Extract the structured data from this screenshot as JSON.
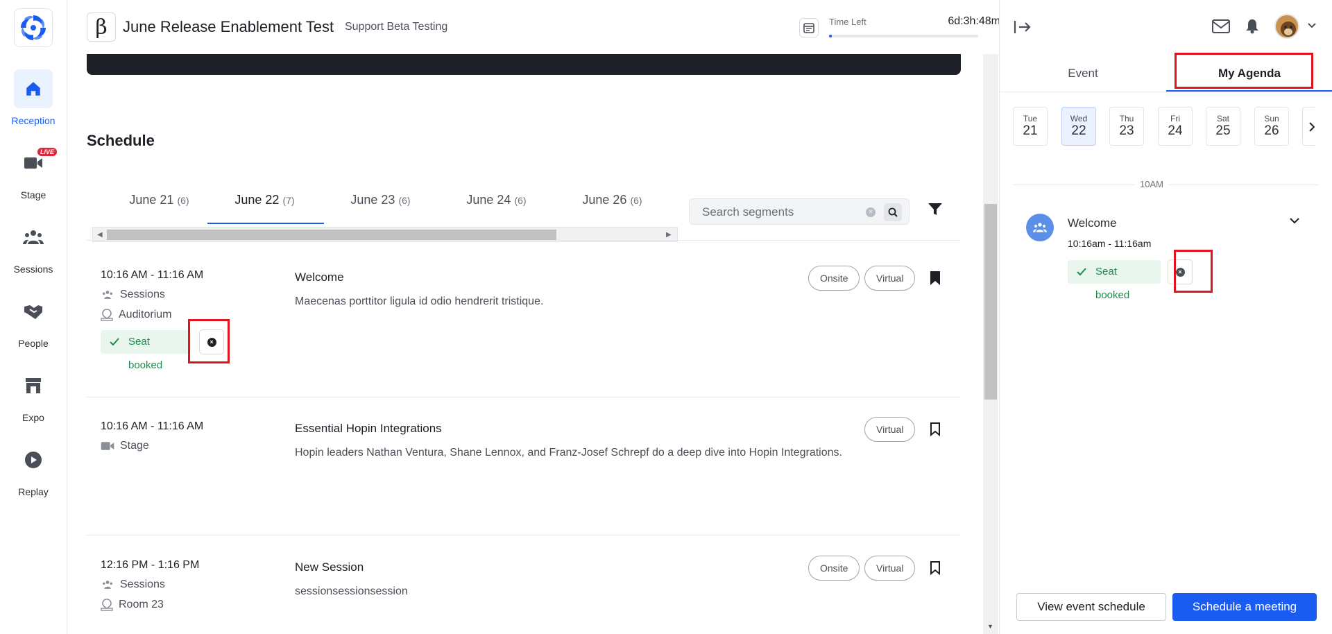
{
  "nav": {
    "items": [
      {
        "label": "Reception",
        "icon": "home-icon",
        "active": true
      },
      {
        "label": "Stage",
        "icon": "video-camera-icon",
        "badge": "LIVE"
      },
      {
        "label": "Sessions",
        "icon": "group-icon"
      },
      {
        "label": "People",
        "icon": "handshake-icon"
      },
      {
        "label": "Expo",
        "icon": "storefront-icon"
      },
      {
        "label": "Replay",
        "icon": "play-circle-icon"
      }
    ]
  },
  "header": {
    "beta_symbol": "β",
    "title": "June Release Enablement Test",
    "subtitle": "Support Beta Testing",
    "time_left_label": "Time Left",
    "time_left_value": "6d:3h:48m",
    "time_left_progress": 0.02
  },
  "schedule": {
    "heading": "Schedule",
    "tabs": [
      {
        "label": "June 21",
        "count": "(6)"
      },
      {
        "label": "June 22",
        "count": "(7)",
        "active": true
      },
      {
        "label": "June 23",
        "count": "(6)"
      },
      {
        "label": "June 24",
        "count": "(6)"
      },
      {
        "label": "June 26",
        "count": "(6)"
      }
    ],
    "search_placeholder": "Search segments",
    "sessions": [
      {
        "time": "10:16 AM - 11:16 AM",
        "type": "Sessions",
        "location": "Auditorium",
        "seat": "Seat booked",
        "title": "Welcome",
        "description": "Maecenas porttitor ligula id odio hendrerit tristique.",
        "tags": [
          "Onsite",
          "Virtual"
        ],
        "bookmarked": true
      },
      {
        "time": "10:16 AM - 11:16 AM",
        "type": "Stage",
        "title": "Essential Hopin Integrations",
        "description": "Hopin leaders Nathan Ventura, Shane Lennox, and Franz-Josef Schrepf do a deep dive into Hopin Integrations.",
        "tags": [
          "Virtual"
        ],
        "bookmarked": false
      },
      {
        "time": "12:16 PM - 1:16 PM",
        "type": "Sessions",
        "location": "Room 23",
        "title": "New Session",
        "description": "sessionsessionsession",
        "tags": [
          "Onsite",
          "Virtual"
        ],
        "bookmarked": false
      }
    ]
  },
  "panel": {
    "tabs": [
      "Event",
      "My Agenda"
    ],
    "days": [
      {
        "name": "Tue",
        "num": "21"
      },
      {
        "name": "Wed",
        "num": "22",
        "active": true
      },
      {
        "name": "Thu",
        "num": "23"
      },
      {
        "name": "Fri",
        "num": "24"
      },
      {
        "name": "Sat",
        "num": "25"
      },
      {
        "name": "Sun",
        "num": "26"
      }
    ],
    "hour_label": "10AM",
    "agenda_item": {
      "title": "Welcome",
      "time": "10:16am - 11:16am",
      "seat": "Seat booked"
    },
    "view_schedule_label": "View event schedule",
    "schedule_meeting_label": "Schedule a meeting"
  },
  "colors": {
    "accent": "#1a5cf2",
    "highlight": "#e0141e",
    "seat_bg": "#e8f6ee",
    "seat_text": "#1e8a4c",
    "live": "#d9283a"
  }
}
